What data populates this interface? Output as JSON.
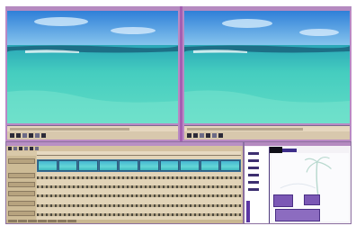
{
  "app": {
    "viewers": [
      {
        "id": "source",
        "title": ""
      },
      {
        "id": "record",
        "title": ""
      }
    ],
    "timeline": {
      "clip_count": 10,
      "track_count": 6
    },
    "bin": {
      "item_count": 6
    }
  },
  "colors": {
    "window_frame": "#b989c4",
    "panel_background": "#d9c9a9",
    "clip_fill": "#46b7d2",
    "accent_purple": "#5b36a3"
  },
  "icons": [
    "play-icon",
    "stop-icon",
    "rewind-icon",
    "fast-forward-icon",
    "mark-in-icon",
    "mark-out-icon"
  ]
}
